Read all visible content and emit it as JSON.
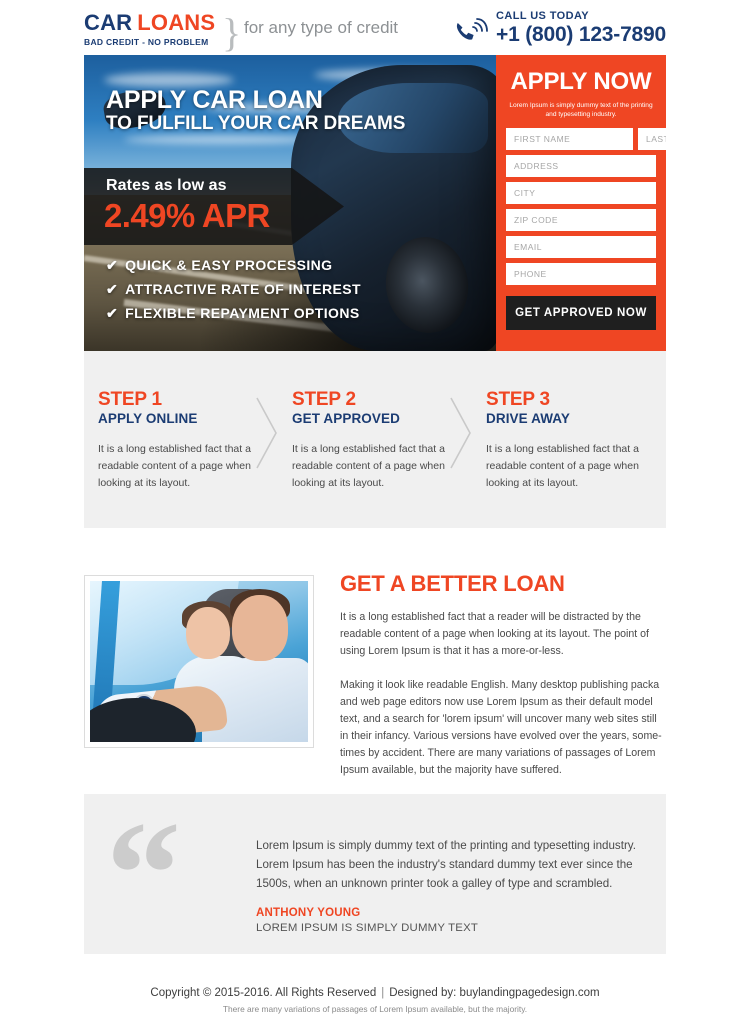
{
  "header": {
    "logo_car": "CAR",
    "logo_loans": "LOANS",
    "logo_sub": "BAD CREDIT - NO PROBLEM",
    "tagline": "for any type of credit",
    "call_label": "CALL US TODAY",
    "phone": "+1 (800) 123-7890",
    "phone_icon": "phone-ringing-icon",
    "brace_glyph": "}"
  },
  "hero": {
    "title": "APPLY CAR LOAN",
    "subtitle": "TO FULFILL YOUR CAR DREAMS",
    "rate_label": "Rates as low as",
    "rate_value": "2.49% APR",
    "bullets": [
      "QUICK & EASY PROCESSING",
      "ATTRACTIVE RATE OF INTEREST",
      "FLEXIBLE REPAYMENT OPTIONS"
    ],
    "tick_glyph": "✔"
  },
  "apply_form": {
    "title": "APPLY NOW",
    "description": "Lorem Ipsum is simply dummy text of the printing and typesetting industry.",
    "fields": [
      {
        "name": "first-name",
        "placeholder": "FIRST NAME",
        "value": ""
      },
      {
        "name": "last-name",
        "placeholder": "LAST NAME",
        "value": ""
      },
      {
        "name": "address",
        "placeholder": "ADDRESS",
        "value": ""
      },
      {
        "name": "city",
        "placeholder": "CITY",
        "value": ""
      },
      {
        "name": "zip-code",
        "placeholder": "ZIP CODE",
        "value": ""
      },
      {
        "name": "email",
        "placeholder": "EMAIL",
        "value": ""
      },
      {
        "name": "phone",
        "placeholder": "PHONE",
        "value": ""
      }
    ],
    "submit_label": "GET APPROVED NOW"
  },
  "steps": [
    {
      "num": "STEP 1",
      "name": "APPLY ONLINE",
      "text": "It is a long established fact that a readable content of a page when looking at its layout."
    },
    {
      "num": "STEP 2",
      "name": "GET APPROVED",
      "text": "It is a long established fact that a readable content of a page when looking at its layout."
    },
    {
      "num": "STEP 3",
      "name": "DRIVE AWAY",
      "text": "It is a long established fact that a readable content of a page when looking at its layout."
    }
  ],
  "better_loan": {
    "title": "GET A BETTER LOAN",
    "photo_alt": "couple-driving-car-photo",
    "paragraph1": "It is a long established fact that a reader will be distracted by the readable content of a page when looking at its layout. The point of using Lorem Ipsum is that it has a more-or-less.",
    "paragraph2": "Making it look like readable English. Many desktop publishing packa and web page editors now use Lorem Ipsum as their default model text, and a search for 'lorem ipsum' will uncover many web sites still in their infancy. Various versions have evolved over the years, some-times by accident. There are many variations of passages of Lorem Ipsum available, but the majority have suffered."
  },
  "testimonial": {
    "quote_glyph": "“",
    "text": "Lorem Ipsum is simply dummy text of the printing and typesetting industry. Lorem Ipsum has been the industry's standard dummy text ever since the 1500s, when an unknown printer took a galley of type and scrambled.",
    "author": "ANTHONY YOUNG",
    "role": "LOREM IPSUM IS SIMPLY DUMMY TEXT"
  },
  "footer": {
    "copyright": "Copyright © 2015-2016. All Rights Reserved",
    "separator": "|",
    "designed_by": "Designed by: buylandingpagedesign.com",
    "note": "There are many variations of passages of Lorem Ipsum available, but the majority."
  },
  "colors": {
    "orange": "#EF4623",
    "navy": "#1B3C73",
    "dark": "#1F1F1F",
    "light_gray": "#F0F0F0",
    "quote_gray": "#CCCCCC"
  }
}
